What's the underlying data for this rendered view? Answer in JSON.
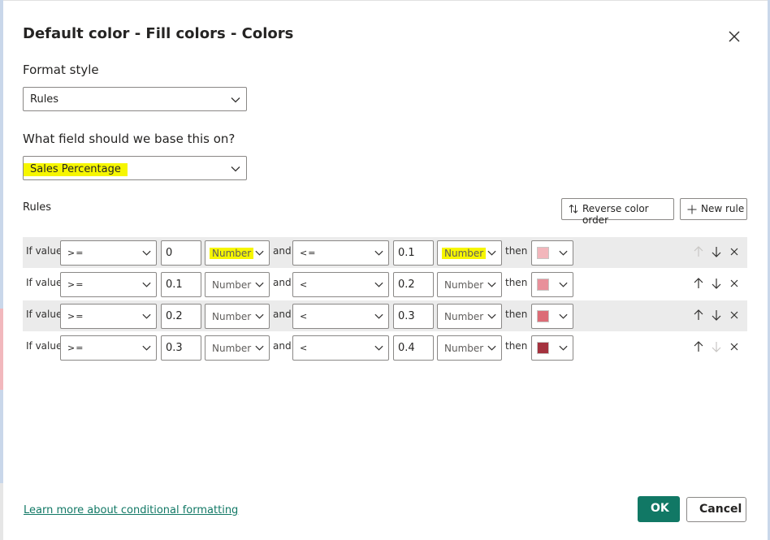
{
  "dialog": {
    "title": "Default color - Fill colors - Colors",
    "format_style_label": "Format style",
    "format_style_value": "Rules",
    "field_label": "What field should we base this on?",
    "field_value": "Sales Percentage",
    "rules_label": "Rules",
    "reverse_label": "Reverse color order",
    "new_rule_label": "New rule",
    "learn_more": "Learn more about conditional formatting",
    "ok_label": "OK",
    "cancel_label": "Cancel"
  },
  "rules": [
    {
      "if": "If value",
      "op1": ">=",
      "val1": "0",
      "type1": "Number",
      "and": "and",
      "op2": "<=",
      "val2": "0.1",
      "type2": "Number",
      "then": "then",
      "color": "#f2b6bb"
    },
    {
      "if": "If value",
      "op1": ">=",
      "val1": "0.1",
      "type1": "Number",
      "and": "and",
      "op2": "<",
      "val2": "0.2",
      "type2": "Number",
      "then": "then",
      "color": "#e8909a"
    },
    {
      "if": "If value",
      "op1": ">=",
      "val1": "0.2",
      "type1": "Number",
      "and": "and",
      "op2": "<",
      "val2": "0.3",
      "type2": "Number",
      "then": "then",
      "color": "#dc6c76"
    },
    {
      "if": "If value",
      "op1": ">=",
      "val1": "0.3",
      "type1": "Number",
      "and": "and",
      "op2": "<",
      "val2": "0.4",
      "type2": "Number",
      "then": "then",
      "color": "#a4323e"
    }
  ],
  "colors": {
    "accent": "#117865",
    "highlight": "#f6f600",
    "row_shade": "#ebebeb"
  }
}
